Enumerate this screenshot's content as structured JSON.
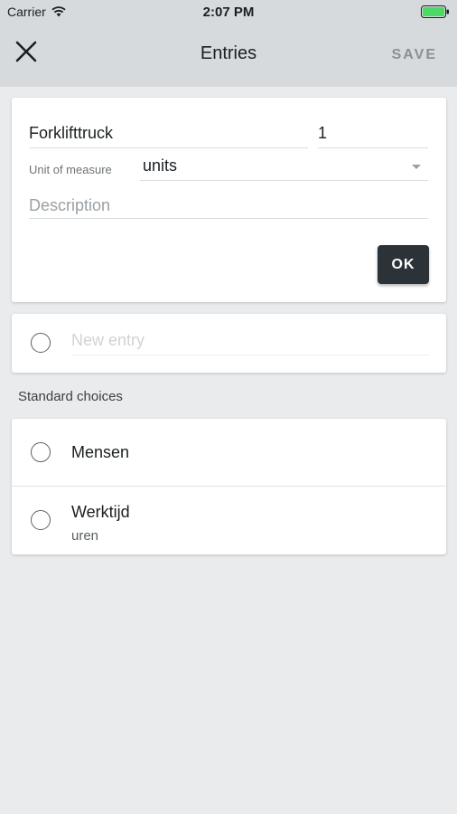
{
  "status": {
    "carrier": "Carrier",
    "time": "2:07 PM"
  },
  "nav": {
    "title": "Entries",
    "save_label": "SAVE"
  },
  "form": {
    "name_value": "Forklifttruck",
    "quantity_value": "1",
    "unit_label": "Unit of measure",
    "unit_value": "units",
    "description_placeholder": "Description",
    "ok_label": "OK"
  },
  "new_entry": {
    "placeholder": "New entry"
  },
  "standard": {
    "heading": "Standard choices",
    "items": [
      {
        "title": "Mensen",
        "subtitle": ""
      },
      {
        "title": "Werktijd",
        "subtitle": "uren"
      }
    ]
  },
  "colors": {
    "nav_bg": "#d6dadc",
    "page_bg": "#e9ebed",
    "ok_bg": "#2b3338",
    "battery": "#4cd964"
  }
}
